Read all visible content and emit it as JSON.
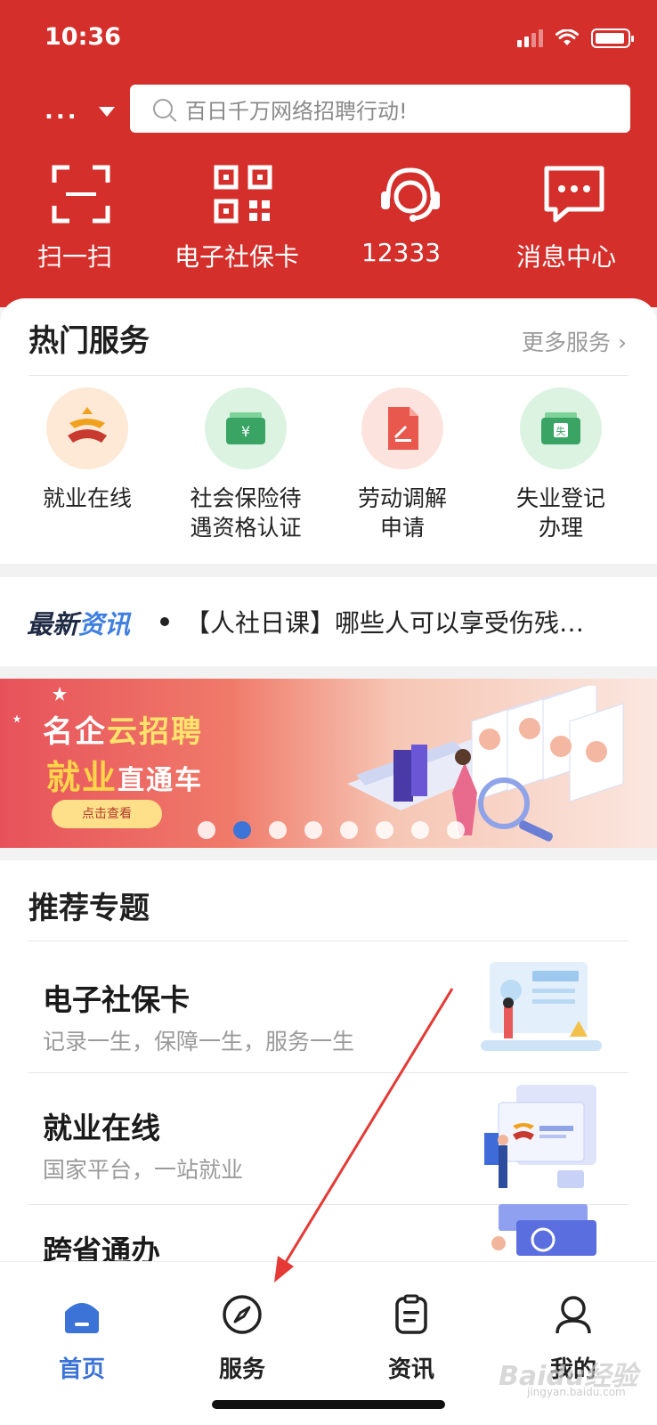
{
  "status_bar": {
    "time": "10:36"
  },
  "header": {
    "city": "...",
    "search_placeholder": "百日千万网络招聘行动!",
    "quick_actions": [
      {
        "label": "扫一扫",
        "icon": "scan-icon"
      },
      {
        "label": "电子社保卡",
        "icon": "qrcode-icon"
      },
      {
        "label": "12333",
        "icon": "headset-icon"
      },
      {
        "label": "消息中心",
        "icon": "message-icon"
      }
    ]
  },
  "hot_services": {
    "title": "热门服务",
    "more": "更多服务 ›",
    "items": [
      {
        "line1": "就业在线",
        "line2": "",
        "icon": "employment-logo-icon",
        "bg": "#fde9d6"
      },
      {
        "line1": "社会保险待",
        "line2": "遇资格认证",
        "icon": "wallet-yen-icon",
        "bg": "#dcf3e2"
      },
      {
        "line1": "劳动调解",
        "line2": "申请",
        "icon": "document-pen-icon",
        "bg": "#fde3de"
      },
      {
        "line1": "失业登记",
        "line2": "办理",
        "icon": "unemployment-card-icon",
        "bg": "#dcf3e2"
      }
    ]
  },
  "news": {
    "badge_a": "最新",
    "badge_b": "资讯",
    "headline": "【人社日课】哪些人可以享受伤残…"
  },
  "banner": {
    "line1_a": "名企",
    "line1_b": "云招聘",
    "line2_a": "就业",
    "line2_b": "直通车",
    "button": "点击查看",
    "slide_count": 8,
    "active_slide": 2
  },
  "recommended": {
    "title": "推荐专题",
    "items": [
      {
        "title": "电子社保卡",
        "subtitle": "记录一生，保障一生，服务一生",
        "icon": "social-card-illustration"
      },
      {
        "title": "就业在线",
        "subtitle": "国家平台，一站就业",
        "icon": "employment-illustration"
      },
      {
        "title": "跨省通办",
        "subtitle": "",
        "icon": "cross-province-illustration"
      }
    ]
  },
  "tabbar": {
    "tabs": [
      {
        "label": "首页",
        "icon": "home-icon",
        "active": true
      },
      {
        "label": "服务",
        "icon": "compass-icon",
        "active": false
      },
      {
        "label": "资讯",
        "icon": "clipboard-icon",
        "active": false
      },
      {
        "label": "我的",
        "icon": "profile-icon",
        "active": false
      }
    ]
  },
  "watermark": {
    "brand": "Baidu经验",
    "url": "jingyan.baidu.com"
  },
  "colors": {
    "header_red": "#d42f2b",
    "accent_blue": "#3b73d6",
    "arrow_red": "#e53935"
  }
}
